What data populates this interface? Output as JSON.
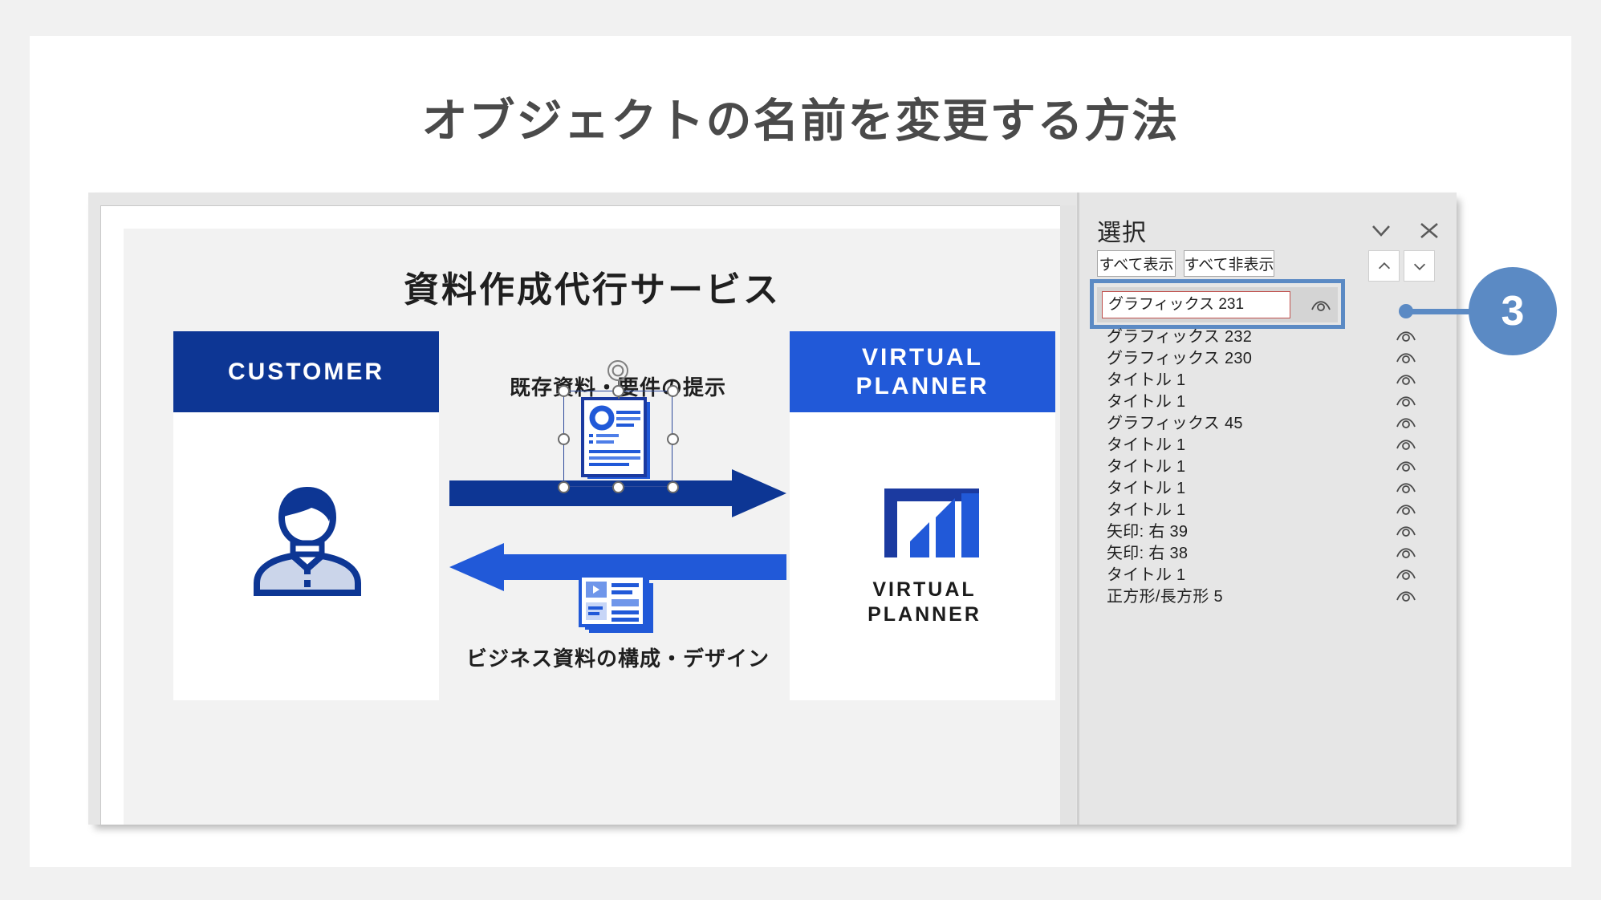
{
  "page": {
    "title": "オブジェクトの名前を変更する方法",
    "background_color": "#f1f1f1",
    "card_color": "#ffffff"
  },
  "slide": {
    "title": "資料作成代行サービス",
    "left_card": {
      "header": "CUSTOMER",
      "header_color": "#0d3694",
      "icon": "person-avatar-icon"
    },
    "right_card": {
      "header_line1": "VIRTUAL",
      "header_line2": "PLANNER",
      "header_color": "#2159d8",
      "logo_name_line1": "VIRTUAL",
      "logo_name_line2": "PLANNER",
      "logo_icon": "bar-chart-logo-icon"
    },
    "flow": {
      "top_label": "既存資料・要件の提示",
      "bottom_label": "ビジネス資料の構成・デザイン",
      "arrow_right_color": "#0d3694",
      "arrow_left_color": "#2159d8",
      "selected_icon": "document-report-icon",
      "bottom_icon": "slide-deck-icon"
    }
  },
  "selection_pane": {
    "title": "選択",
    "collapse_icon": "chevron-down-icon",
    "close_icon": "close-icon",
    "show_all_label": "すべて表示",
    "hide_all_label": "すべて非表示",
    "move_up_icon": "chevron-up-icon",
    "move_down_icon": "chevron-down-icon",
    "editing_row": {
      "value": "グラフィックス 231",
      "eye_icon": "eye-visible-icon",
      "input_border_color": "#c0504d",
      "highlight_color": "#5b8ac4"
    },
    "items": [
      {
        "label": "グラフィックス 232",
        "eye_icon": "eye-visible-icon"
      },
      {
        "label": "グラフィックス 230",
        "eye_icon": "eye-visible-icon"
      },
      {
        "label": "タイトル 1",
        "eye_icon": "eye-visible-icon"
      },
      {
        "label": "タイトル 1",
        "eye_icon": "eye-visible-icon"
      },
      {
        "label": "グラフィックス 45",
        "eye_icon": "eye-visible-icon"
      },
      {
        "label": "タイトル 1",
        "eye_icon": "eye-visible-icon"
      },
      {
        "label": "タイトル 1",
        "eye_icon": "eye-visible-icon"
      },
      {
        "label": "タイトル 1",
        "eye_icon": "eye-visible-icon"
      },
      {
        "label": "タイトル 1",
        "eye_icon": "eye-visible-icon"
      },
      {
        "label": "矢印: 右 39",
        "eye_icon": "eye-visible-icon"
      },
      {
        "label": "矢印: 右 38",
        "eye_icon": "eye-visible-icon"
      },
      {
        "label": "タイトル 1",
        "eye_icon": "eye-visible-icon"
      },
      {
        "label": "正方形/長方形 5",
        "eye_icon": "eye-visible-icon"
      }
    ]
  },
  "callout": {
    "number": "3",
    "color": "#5b8ac4"
  }
}
